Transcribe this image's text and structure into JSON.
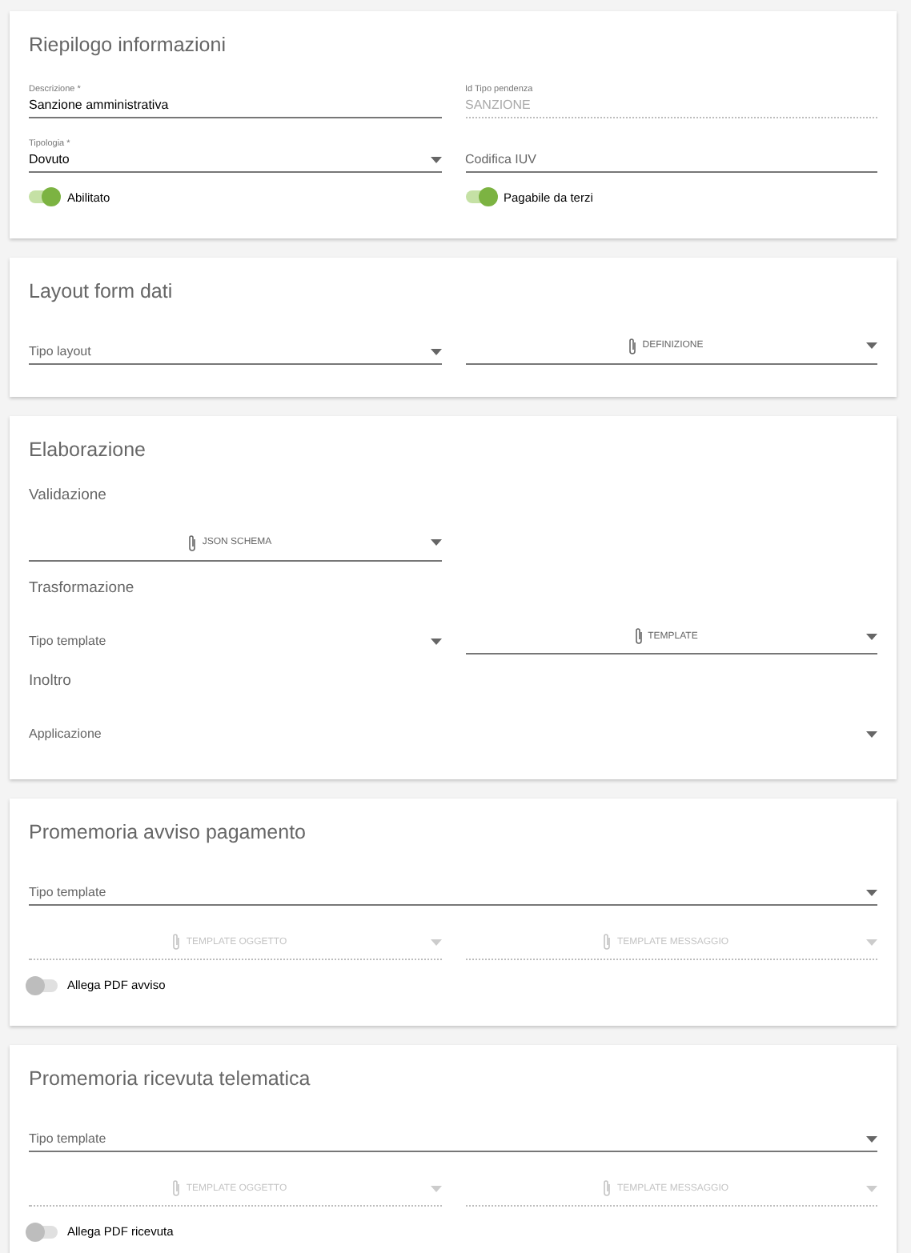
{
  "cards": [
    {
      "title": "Riepilogo informazioni",
      "rows": [
        {
          "kind": "fields",
          "fields": [
            {
              "kind": "text",
              "label": "Descrizione *",
              "value": "Sanzione amministrativa",
              "disabled": false
            },
            {
              "kind": "text",
              "label": "Id Tipo pendenza",
              "value": "SANZIONE",
              "disabled": true
            }
          ]
        },
        {
          "kind": "fields",
          "fields": [
            {
              "kind": "select",
              "label": "Tipologia *",
              "value": "Dovuto",
              "disabled": false
            },
            {
              "kind": "text",
              "placeholder": "Codifica IUV",
              "disabled": false
            }
          ]
        },
        {
          "kind": "fields",
          "fields": [
            {
              "kind": "toggle",
              "label": "Abilitato",
              "on": true
            },
            {
              "kind": "toggle",
              "label": "Pagabile da terzi",
              "on": true
            }
          ]
        }
      ]
    },
    {
      "title": "Layout form dati",
      "rows": [
        {
          "kind": "fields",
          "fields": [
            {
              "kind": "select",
              "placeholder": "Tipo layout",
              "disabled": false
            },
            {
              "kind": "file",
              "label": "DEFINIZIONE",
              "disabled": false
            }
          ]
        }
      ]
    },
    {
      "title": "Elaborazione",
      "rows": [
        {
          "kind": "subheading",
          "text": "Validazione"
        },
        {
          "kind": "fields",
          "fields": [
            {
              "kind": "file",
              "label": "JSON SCHEMA",
              "disabled": false
            }
          ]
        },
        {
          "kind": "subheading",
          "text": "Trasformazione"
        },
        {
          "kind": "fields",
          "fields": [
            {
              "kind": "select",
              "placeholder": "Tipo template",
              "disabled": false,
              "underline": false
            },
            {
              "kind": "file",
              "label": "TEMPLATE",
              "disabled": false
            }
          ]
        },
        {
          "kind": "subheading",
          "text": "Inoltro"
        },
        {
          "kind": "fields",
          "fields": [
            {
              "kind": "select",
              "placeholder": "Applicazione",
              "disabled": false,
              "underline": false,
              "wide": true
            }
          ]
        }
      ]
    },
    {
      "title": "Promemoria avviso pagamento",
      "rows": [
        {
          "kind": "fields",
          "fields": [
            {
              "kind": "select",
              "placeholder": "Tipo template",
              "disabled": false,
              "wide": true
            }
          ]
        },
        {
          "kind": "fields",
          "fields": [
            {
              "kind": "file",
              "label": "TEMPLATE OGGETTO",
              "disabled": true
            },
            {
              "kind": "file",
              "label": "TEMPLATE MESSAGGIO",
              "disabled": true
            }
          ]
        },
        {
          "kind": "fields",
          "fields": [
            {
              "kind": "toggle",
              "label": "Allega PDF avviso",
              "on": false
            }
          ]
        }
      ]
    },
    {
      "title": "Promemoria ricevuta telematica",
      "rows": [
        {
          "kind": "fields",
          "fields": [
            {
              "kind": "select",
              "placeholder": "Tipo template",
              "disabled": false,
              "wide": true
            }
          ]
        },
        {
          "kind": "fields",
          "fields": [
            {
              "kind": "file",
              "label": "TEMPLATE OGGETTO",
              "disabled": true
            },
            {
              "kind": "file",
              "label": "TEMPLATE MESSAGGIO",
              "disabled": true
            }
          ]
        },
        {
          "kind": "fields",
          "fields": [
            {
              "kind": "toggle",
              "label": "Allega PDF ricevuta",
              "on": false
            }
          ]
        }
      ]
    }
  ]
}
